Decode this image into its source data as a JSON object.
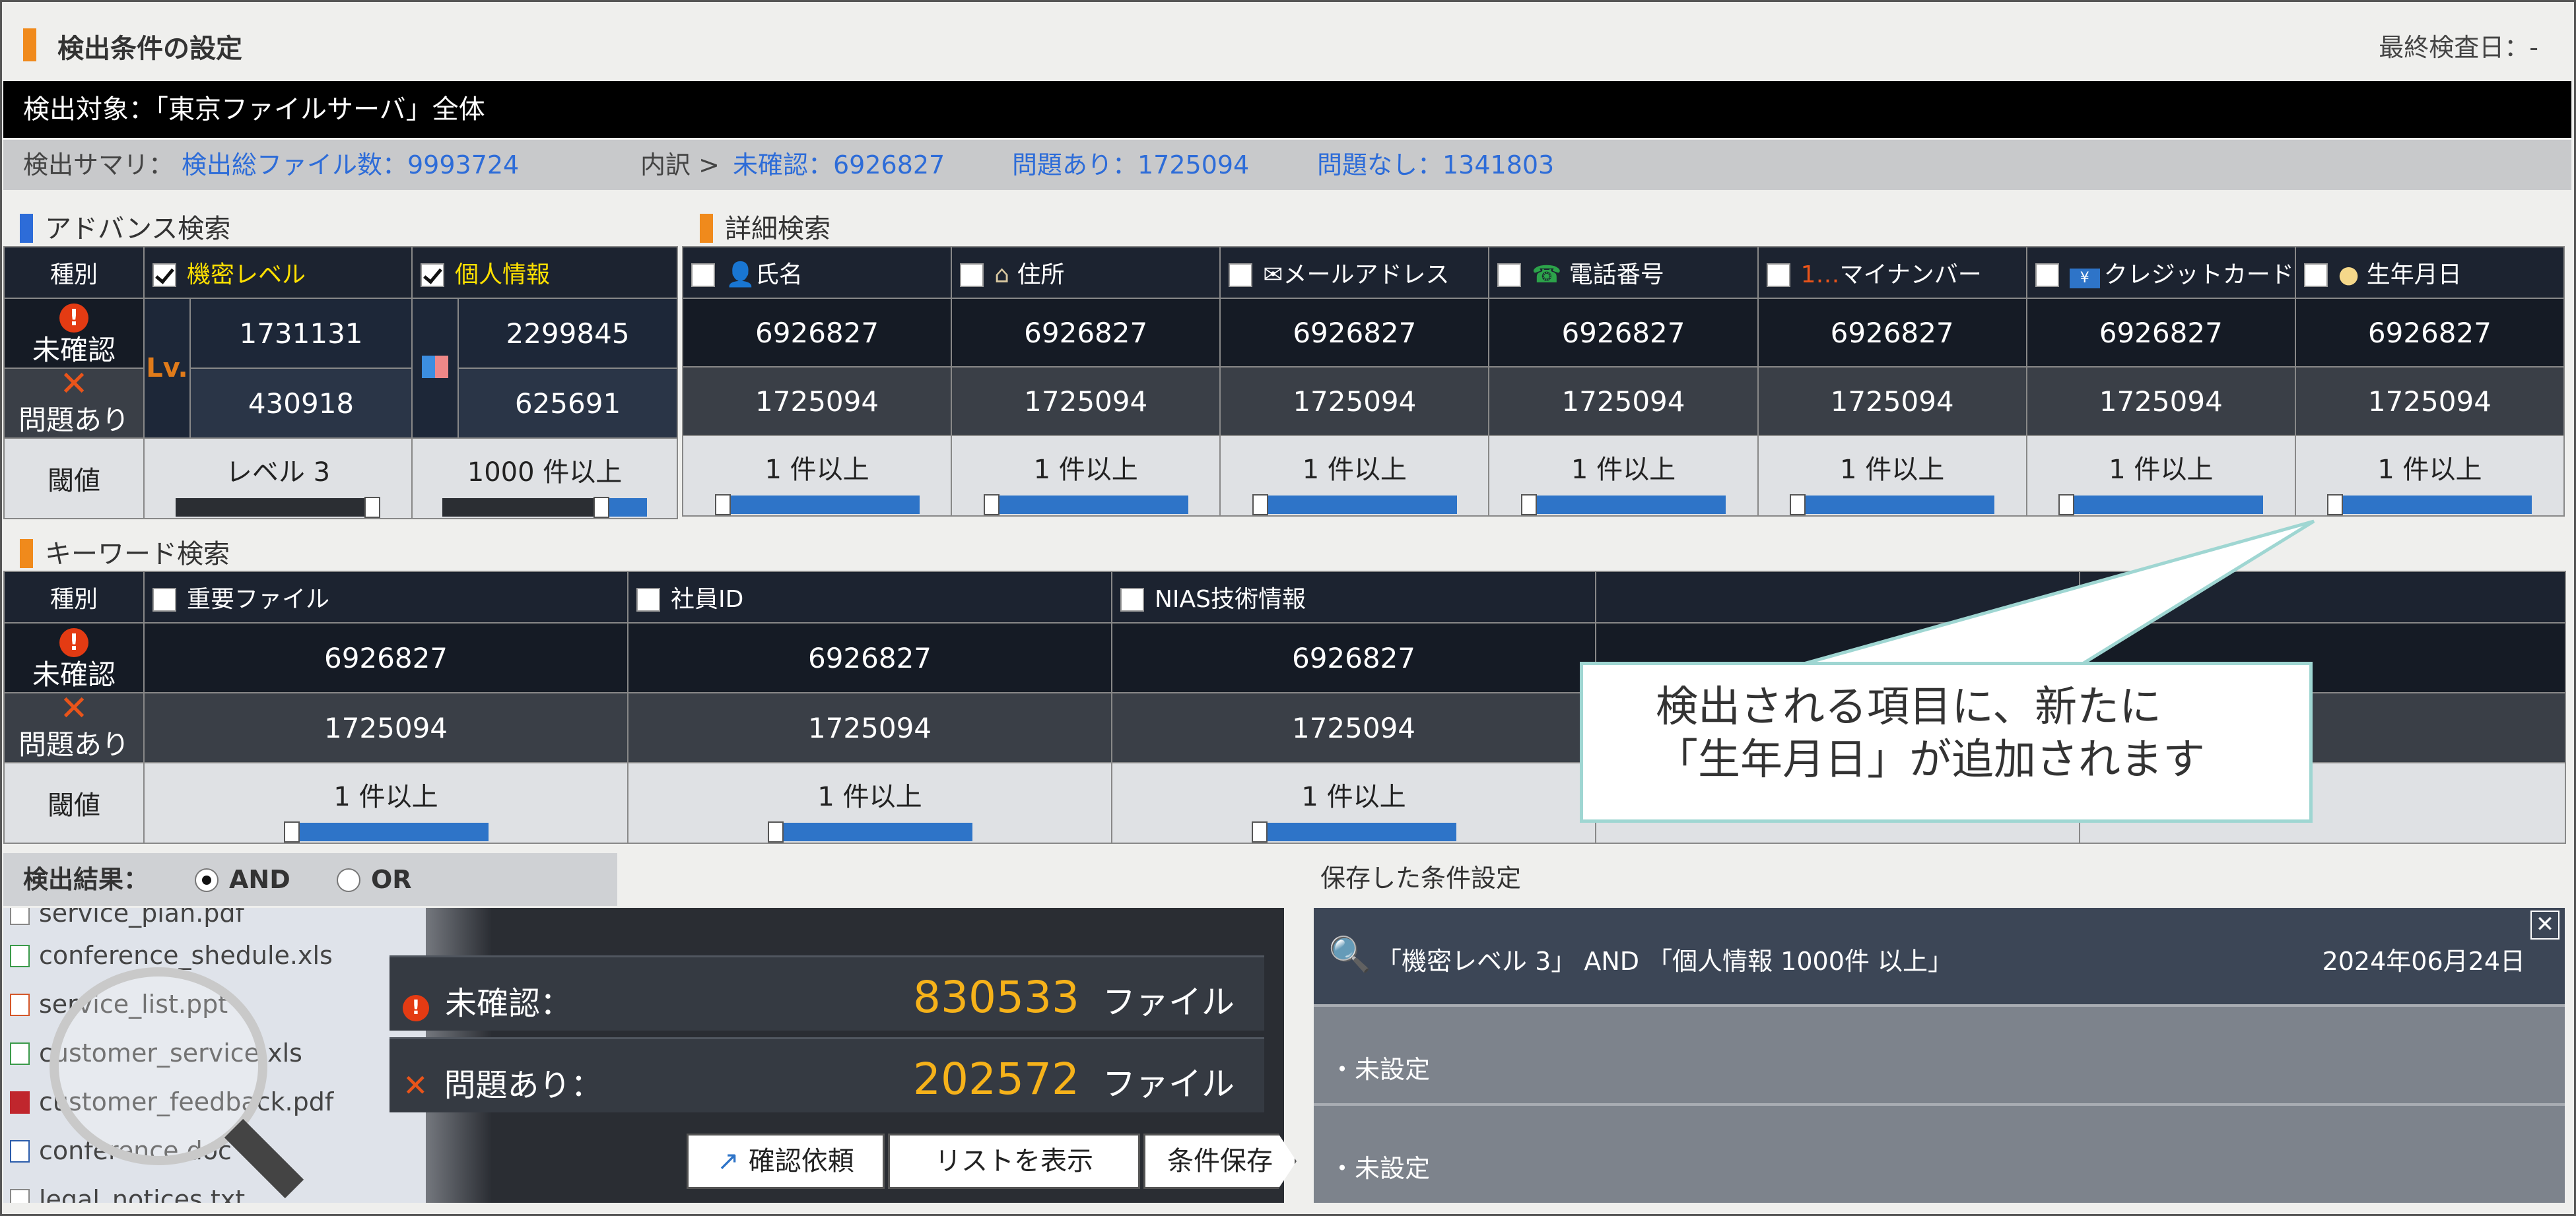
{
  "header": {
    "title": "検出条件の設定",
    "last_check": "最終検査日：-"
  },
  "target": "検出対象：「東京ファイルサーバ」全体",
  "summary": {
    "label": "検出サマリ：",
    "total": "検出総ファイル数：9993724",
    "breakdown": "内訳 >",
    "unconfirmed": "未確認：6926827",
    "issue": "問題あり：1725094",
    "no_issue": "問題なし：1341803"
  },
  "advance": {
    "title": "アドバンス検索"
  },
  "detail": {
    "title": "詳細検索"
  },
  "keyword": {
    "title": "キーワード検索"
  },
  "labels": {
    "kind": "種別",
    "unconfirmed": "未確認",
    "issue": "問題あり",
    "threshold": "閾値",
    "lv": "Lv."
  },
  "adv_cols": [
    {
      "name": "機密レベル",
      "checked": true,
      "unconf": "1731131",
      "issue": "430918",
      "thr": "レベル 3"
    },
    {
      "name": "個人情報",
      "checked": true,
      "unconf": "2299845",
      "issue": "625691",
      "thr": "1000 件以上"
    }
  ],
  "detail_cols": [
    {
      "name": "氏名",
      "icon": "person-icon",
      "unconf": "6926827",
      "issue": "1725094",
      "thr": "1 件以上"
    },
    {
      "name": "住所",
      "icon": "house-icon",
      "unconf": "6926827",
      "issue": "1725094",
      "thr": "1 件以上"
    },
    {
      "name": "メールアドレス",
      "icon": "mail-icon",
      "unconf": "6926827",
      "issue": "1725094",
      "thr": "1 件以上"
    },
    {
      "name": "電話番号",
      "icon": "phone-icon",
      "unconf": "6926827",
      "issue": "1725094",
      "thr": "1 件以上"
    },
    {
      "name": "マイナンバー",
      "icon": "mynumber-icon",
      "prefix": "1…",
      "unconf": "6926827",
      "issue": "1725094",
      "thr": "1 件以上"
    },
    {
      "name": "クレジットカード",
      "icon": "credit-card-icon",
      "unconf": "6926827",
      "issue": "1725094",
      "thr": "1 件以上"
    },
    {
      "name": "生年月日",
      "icon": "cake-icon",
      "unconf": "6926827",
      "issue": "1725094",
      "thr": "1 件以上"
    }
  ],
  "keyword_cols": [
    {
      "name": "重要ファイル",
      "unconf": "6926827",
      "issue": "1725094",
      "thr": "1 件以上"
    },
    {
      "name": "社員ID",
      "unconf": "6926827",
      "issue": "1725094",
      "thr": "1 件以上"
    },
    {
      "name": "NIAS技術情報",
      "unconf": "6926827",
      "issue": "1725094",
      "thr": "1 件以上"
    }
  ],
  "callout": {
    "line1": "検出される項目に、新たに",
    "line2": "「生年月日」が追加されます"
  },
  "result": {
    "label": "検出結果：",
    "and": "AND",
    "or": "OR"
  },
  "files": [
    "service_plan.pdf",
    "conference_shedule.xls",
    "service_list.ppt",
    "customer_service.xls",
    "customer_feedback.pdf",
    "conference.doc",
    "legal_notices.txt"
  ],
  "stats": {
    "unconfirmed_label": "未確認：",
    "unconfirmed_value": "830533",
    "issue_label": "問題あり：",
    "issue_value": "202572",
    "unit": "ファイル"
  },
  "buttons": {
    "request": "確認依頼",
    "list": "リストを表示",
    "save": "条件保存"
  },
  "saved": {
    "title": "保存した条件設定",
    "item1": "「機密レベル 3」 AND 「個人情報 1000件 以上」",
    "item1_date": "2024年06月24日",
    "item2": "・未設定",
    "item3": "・未設定"
  },
  "colors": {
    "accent_orange": "#f08a1c",
    "accent_blue": "#2d6cd8",
    "yellow": "#ffe000",
    "value_gold": "#f6b21a"
  }
}
